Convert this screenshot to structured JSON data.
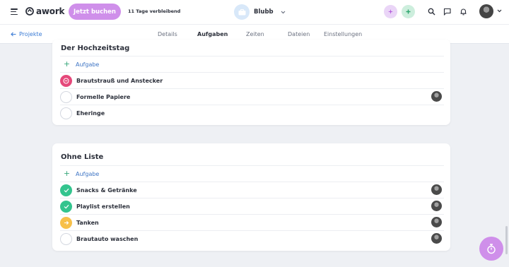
{
  "topbar": {
    "logo_text": "awork",
    "cta_label": "Jetzt buchen",
    "trial_text": "11 Tage verbleibend",
    "workspace_name": "Blubb"
  },
  "subnav": {
    "back_label": "Projekte",
    "tabs": [
      {
        "label": "Details",
        "active": false
      },
      {
        "label": "Aufgaben",
        "active": true
      },
      {
        "label": "Zeiten",
        "active": false
      },
      {
        "label": "Dateien",
        "active": false
      },
      {
        "label": "Einstellungen",
        "active": false
      }
    ]
  },
  "lists": [
    {
      "title": "Der Hochzeitstag",
      "add_label": "Aufgabe",
      "tasks": [
        {
          "name": "Brautstrauß und Anstecker",
          "status": "blocked",
          "assigned": false
        },
        {
          "name": "Formelle Papiere",
          "status": "open",
          "assigned": true
        },
        {
          "name": "Eheringe",
          "status": "open",
          "assigned": false
        }
      ]
    },
    {
      "title": "Ohne Liste",
      "add_label": "Aufgabe",
      "tasks": [
        {
          "name": "Snacks & Getränke",
          "status": "done",
          "assigned": true
        },
        {
          "name": "Playlist erstellen",
          "status": "done",
          "assigned": true
        },
        {
          "name": "Tanken",
          "status": "in-progress",
          "assigned": true
        },
        {
          "name": "Brautauto waschen",
          "status": "open",
          "assigned": true
        }
      ]
    }
  ],
  "colors": {
    "accent": "#cf8fea",
    "done": "#33c48e",
    "blocked": "#e5487a",
    "in_progress": "#f7c04a",
    "tab_underline": "#2fa7c9"
  }
}
